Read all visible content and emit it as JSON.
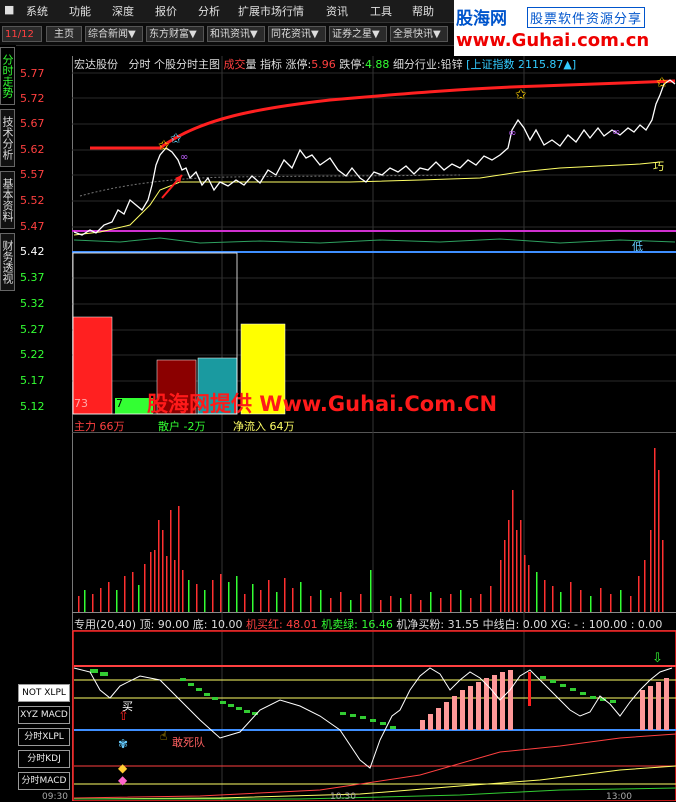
{
  "menu": [
    "系统",
    "功能",
    "深度",
    "报价",
    "分析",
    "扩展市场行情",
    "资讯",
    "工具",
    "帮助"
  ],
  "toolbar": {
    "date": "11/12",
    "home": "主页",
    "buttons": [
      "综合新闻▼",
      "东方财富▼",
      "和讯资讯▼",
      "同花资讯▼",
      "证券之星▼",
      "全景快讯▼"
    ]
  },
  "brand": {
    "logo": "股海网",
    "slogan": "股票软件资源分享",
    "url": "www.Guhai.com.cn"
  },
  "sidetabs": [
    "分时走势",
    "技术分析",
    "基本资料",
    "财务透视"
  ],
  "stock_header": {
    "name": "宏达股份",
    "mode": "分时",
    "title": "个股分时主图",
    "chengjiao_a": "成交",
    "chengjiao_b": "量",
    "indicator": "指标",
    "limit_up_label": "涨停:",
    "limit_up": "5.96",
    "limit_down_label": "跌停:",
    "limit_down": "4.88",
    "industry": "细分行业:铅锌",
    "index": "[上证指数 2115.87▲]"
  },
  "price_axis": [
    "5.77",
    "5.72",
    "5.67",
    "5.62",
    "5.57",
    "5.52",
    "5.47",
    "5.42",
    "5.37",
    "5.32",
    "5.27",
    "5.22",
    "5.17",
    "5.12"
  ],
  "flow": {
    "main_force": "主力 66万",
    "retail": "散户 -2万",
    "net_inflow": "净流入 64万",
    "bar_value_label": "73",
    "bar_small_label": "7"
  },
  "watermark": "股海网提供 Www.Guhai.Com.CN",
  "indicator_header": {
    "name": "专用(20,40)",
    "top": "顶: 90.00",
    "bottom": "底: 10.00",
    "buy_red": "机买红: 48.01",
    "sell_green": "机卖绿: 16.46",
    "net_buy": "机净买粉: 31.55",
    "mid_white": "中线白: 0.00",
    "xg": "XG: - : 100.00 : 0.00"
  },
  "indicator_buttons": [
    "NOT XLPL",
    "XYZ MACD",
    "分时XLPL",
    "分时KDJ",
    "分时MACD"
  ],
  "annotations": {
    "buy": "买",
    "dead_queue": "敢死队",
    "cross": "巧",
    "low": "低"
  },
  "time_axis": [
    "09:30",
    "10:30",
    "13:00"
  ],
  "colors": {
    "price_line": "#ffffff",
    "avg_line": "#ffff66",
    "trend_line": "#ff2020",
    "up": "#ff3030",
    "down": "#33ff33"
  }
}
